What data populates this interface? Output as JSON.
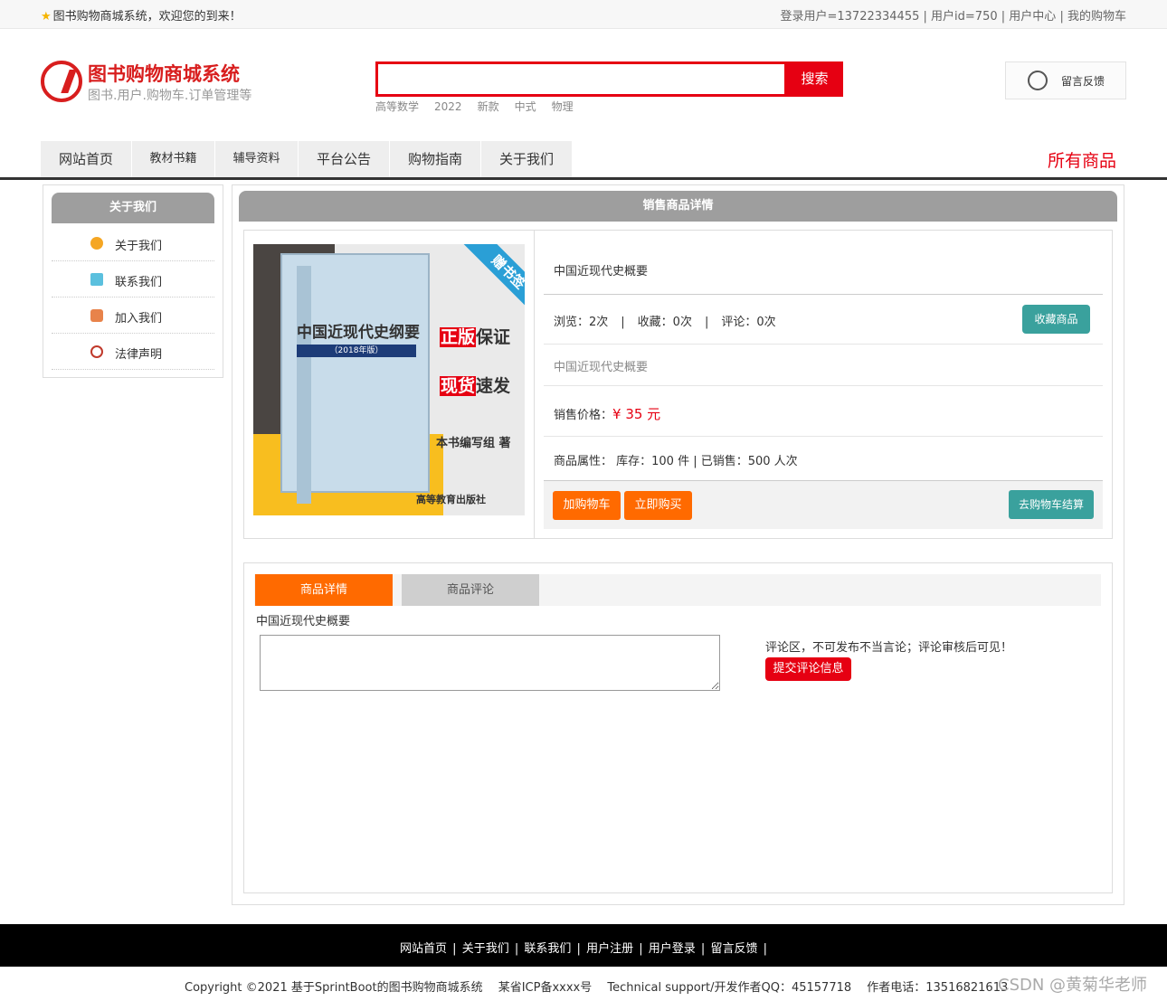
{
  "topbar": {
    "welcome": "图书购物商城系统，欢迎您的到来！",
    "login_info": "登录用户=13722334455",
    "user_id": "用户id=750",
    "user_center": "用户中心",
    "my_cart": "我的购物车",
    "separator": "|"
  },
  "header": {
    "site_name": "图书购物商城系统",
    "site_sub": "图书.用户.购物车.订单管理等",
    "search_value": "",
    "search_label": "搜索",
    "hot_words": [
      "高等数学",
      "2022",
      "新款",
      "中式",
      "物理"
    ],
    "feedback_label": "留言反馈"
  },
  "nav": {
    "items": [
      "网站首页",
      "教材书籍",
      "辅导资料",
      "平台公告",
      "购物指南",
      "关于我们"
    ],
    "all_goods": "所有商品"
  },
  "sidebar": {
    "title": "关于我们",
    "items": [
      "关于我们",
      "联系我们",
      "加入我们",
      "法律声明"
    ]
  },
  "product": {
    "section_title": "销售商品详情",
    "name": "中国近现代史概要",
    "views": "浏览：2次",
    "favorites": "收藏：0次",
    "comments": "评论：0次",
    "stat_sep": "|",
    "favorite_button": "收藏商品",
    "subtitle": "中国近现代史概要",
    "price_label": "销售价格：",
    "price_value": "¥ 35 元",
    "attrs": "商品属性： 库存：100 件 | 已销售：500 人次",
    "add_cart": "加购物车",
    "buy_now": "立即购买",
    "checkout": "去购物车结算",
    "cover": {
      "title": "中国近现代史纲要",
      "edition": "（2018年版）",
      "tag1_red": "正版",
      "tag1_rest": "保证",
      "tag2_red": "现货",
      "tag2_rest": "速发",
      "author": "本书编写组 著",
      "publisher": "高等教育出版社",
      "ribbon": "赠书签"
    }
  },
  "detail": {
    "tab_detail": "商品详情",
    "tab_comments": "商品评论",
    "detail_text": "中国近现代史概要",
    "comment_value": "",
    "comment_note": "评论区，不可发布不当言论；评论审核后可见！",
    "submit_button": "提交评论信息"
  },
  "footer": {
    "links": [
      "网站首页",
      "关于我们",
      "联系我们",
      "用户注册",
      "用户登录",
      "留言反馈"
    ],
    "separator": "|",
    "copyright": "Copyright ©2021 基于SprintBoot的图书购物商城系统　 某省ICP备xxxx号　 Technical support/开发作者QQ：45157718　 作者电话：13516821613"
  },
  "watermark": "CSDN @黄菊华老师",
  "colors": {
    "accent_red": "#e60012",
    "accent_orange": "#ff6a00",
    "teal": "#3aa19d",
    "header_gray": "#9e9e9e"
  }
}
